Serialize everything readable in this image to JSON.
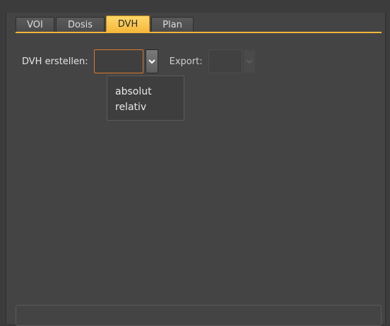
{
  "tabs": [
    {
      "label": "VOI",
      "active": false
    },
    {
      "label": "Dosis",
      "active": false
    },
    {
      "label": "DVH",
      "active": true
    },
    {
      "label": "Plan",
      "active": false
    }
  ],
  "dvh": {
    "create_label": "DVH erstellen:",
    "create_value": "",
    "export_label": "Export:",
    "export_value": "",
    "export_enabled": false,
    "dropdown_open": true,
    "options": [
      "absolut",
      "relativ"
    ]
  },
  "colors": {
    "accent": "#f4b53a",
    "active_tab": "#ffd76a",
    "focus_border": "#e07a2a",
    "background": "#444444"
  }
}
